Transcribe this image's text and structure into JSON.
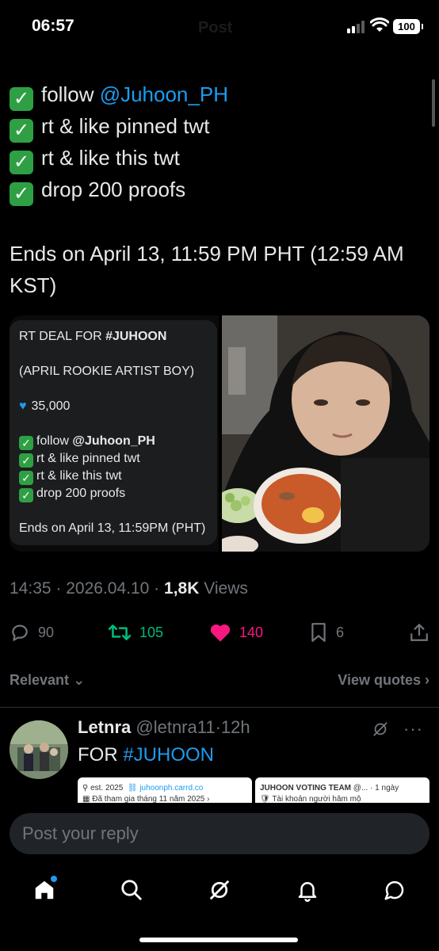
{
  "status": {
    "time": "06:57",
    "ghost_title": "Post",
    "battery": "100"
  },
  "tweet": {
    "checklist": [
      {
        "prefix": "follow ",
        "mention": "@Juhoon_PH"
      },
      {
        "prefix": "rt & like pinned twt",
        "mention": ""
      },
      {
        "prefix": "rt & like this twt",
        "mention": ""
      },
      {
        "prefix": "drop 200 proofs",
        "mention": ""
      }
    ],
    "ends": "Ends on April 13, 11:59 PM PHT (12:59 AM KST)"
  },
  "card": {
    "title_prefix": "RT DEAL FOR ",
    "title_tag": "#JUHOON",
    "subtitle": "(APRIL ROOKIE ARTIST BOY)",
    "amount": "35,000",
    "items": [
      {
        "prefix": "follow ",
        "bold": "@Juhoon_PH"
      },
      {
        "prefix": "rt & like pinned twt",
        "bold": ""
      },
      {
        "prefix": "rt & like this twt",
        "bold": ""
      },
      {
        "prefix": "drop 200 proofs",
        "bold": ""
      }
    ],
    "ends": "Ends on April 13, 11:59PM (PHT)"
  },
  "meta": {
    "time": "14:35",
    "date": "2026.04.10",
    "views_count": "1,8K",
    "views_label": "Views"
  },
  "actions": {
    "replies": "90",
    "reposts": "105",
    "likes": "140",
    "bookmarks": "6"
  },
  "filter": {
    "label": "Relevant",
    "view_quotes": "View quotes"
  },
  "reply": {
    "name": "Letnra",
    "handle": "@letnra11",
    "time": "12h",
    "text_prefix": "FOR ",
    "text_tag": "#JUHOON",
    "thumb1_line1": "est. 2025",
    "thumb1_link": "juhoonph.carrd.co",
    "thumb1_line2": "Đã tham gia tháng 11 năm 2025",
    "thumb2_name": "JUHOON VOTING TEAM",
    "thumb2_handle": "@...",
    "thumb2_time": "· 1 ngày",
    "thumb2_line2": "Tài khoản người hâm mộ"
  },
  "composer": {
    "placeholder": "Post your reply"
  },
  "colors": {
    "accent": "#1d9bf0",
    "repost": "#00ba7c",
    "like": "#f91880",
    "check": "#2ea043"
  }
}
